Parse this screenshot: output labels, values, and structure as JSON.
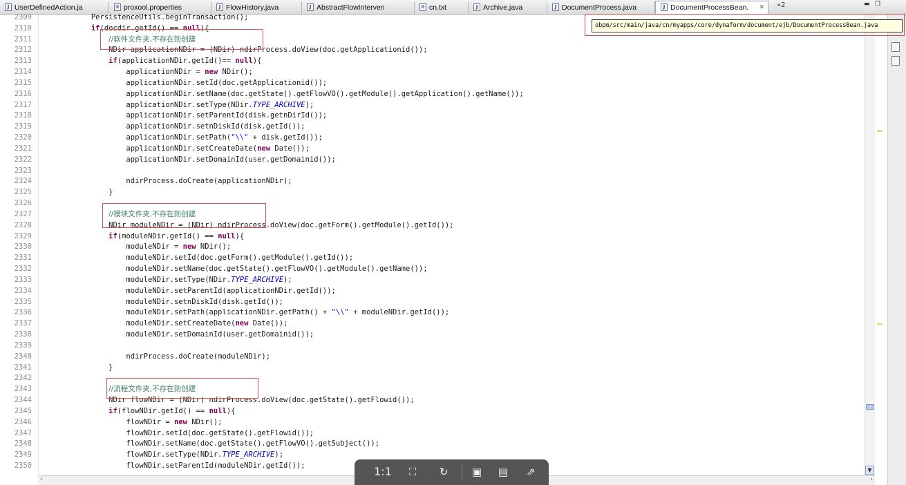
{
  "tabs": [
    {
      "label": "UserDefinedAction.ja",
      "icon": "java-file-icon"
    },
    {
      "label": "proxool.properties",
      "icon": "properties-file-icon"
    },
    {
      "label": "FlowHistory.java",
      "icon": "java-file-icon"
    },
    {
      "label": "AbstractFlowInterven",
      "icon": "java-file-icon"
    },
    {
      "label": "cn.txt",
      "icon": "text-file-icon"
    },
    {
      "label": "Archive.java",
      "icon": "java-file-icon"
    },
    {
      "label": "DocumentProcess.java",
      "icon": "java-file-icon"
    },
    {
      "label": "DocumentProcessBean.",
      "icon": "java-file-icon",
      "active": true
    }
  ],
  "more_tabs": "»2",
  "tooltip_path": "obpm/src/main/java/cn/myapps/core/dynaform/document/ejb/DocumentProcessBean.java",
  "lines": [
    {
      "n": "2309",
      "html": "            PersistenceUtils.beginTransaction();"
    },
    {
      "n": "2310",
      "html": "            <span class='kw'>if</span>(docdir.getId() == <span class='kw'>null</span>){"
    },
    {
      "n": "2311",
      "html": "                <span class='cm'>//软件文件夹,不存在则创建</span>"
    },
    {
      "n": "2312",
      "html": "                NDir applicationNDir = (NDir) ndirProcess.doView(doc.getApplicationid());"
    },
    {
      "n": "2313",
      "html": "                <span class='kw'>if</span>(applicationNDir.getId()== <span class='kw'>null</span>){"
    },
    {
      "n": "2314",
      "html": "                    applicationNDir = <span class='kw'>new</span> NDir();"
    },
    {
      "n": "2315",
      "html": "                    applicationNDir.setId(doc.getApplicationid());"
    },
    {
      "n": "2316",
      "html": "                    applicationNDir.setName(doc.getState().getFlowVO().getModule().getApplication().getName());"
    },
    {
      "n": "2317",
      "html": "                    applicationNDir.setType(NDir.<span class='sf'>TYPE_ARCHIVE</span>);"
    },
    {
      "n": "2318",
      "html": "                    applicationNDir.setParentId(disk.getnDirId());"
    },
    {
      "n": "2319",
      "html": "                    applicationNDir.setnDiskId(disk.getId());"
    },
    {
      "n": "2320",
      "html": "                    applicationNDir.setPath(<span class='st'>\"\\\\\"</span> + disk.getId());"
    },
    {
      "n": "2321",
      "html": "                    applicationNDir.setCreateDate(<span class='kw'>new</span> Date());"
    },
    {
      "n": "2322",
      "html": "                    applicationNDir.setDomainId(user.getDomainid());"
    },
    {
      "n": "2323",
      "html": ""
    },
    {
      "n": "2324",
      "html": "                    ndirProcess.doCreate(applicationNDir);"
    },
    {
      "n": "2325",
      "html": "                }"
    },
    {
      "n": "2326",
      "html": ""
    },
    {
      "n": "2327",
      "html": "                <span class='cm'>//模块文件夹,不存在则创建</span>"
    },
    {
      "n": "2328",
      "html": "                NDir moduleNDir = (NDir) ndirProcess.doView(doc.getForm().getModule().getId());"
    },
    {
      "n": "2329",
      "html": "                <span class='kw'>if</span>(moduleNDir.getId() == <span class='kw'>null</span>){"
    },
    {
      "n": "2330",
      "html": "                    moduleNDir = <span class='kw'>new</span> NDir();"
    },
    {
      "n": "2331",
      "html": "                    moduleNDir.setId(doc.getForm().getModule().getId());"
    },
    {
      "n": "2332",
      "html": "                    moduleNDir.setName(doc.getState().getFlowVO().getModule().getName());"
    },
    {
      "n": "2333",
      "html": "                    moduleNDir.setType(NDir.<span class='sf'>TYPE_ARCHIVE</span>);"
    },
    {
      "n": "2334",
      "html": "                    moduleNDir.setParentId(applicationNDir.getId());"
    },
    {
      "n": "2335",
      "html": "                    moduleNDir.setnDiskId(disk.getId());"
    },
    {
      "n": "2336",
      "html": "                    moduleNDir.setPath(applicationNDir.getPath() + <span class='st'>\"\\\\\"</span> + moduleNDir.getId());"
    },
    {
      "n": "2337",
      "html": "                    moduleNDir.setCreateDate(<span class='kw'>new</span> Date());"
    },
    {
      "n": "2338",
      "html": "                    moduleNDir.setDomainId(user.getDomainid());"
    },
    {
      "n": "2339",
      "html": ""
    },
    {
      "n": "2340",
      "html": "                    ndirProcess.doCreate(moduleNDir);"
    },
    {
      "n": "2341",
      "html": "                }"
    },
    {
      "n": "2342",
      "html": ""
    },
    {
      "n": "2343",
      "html": "                <span class='cm'>//流程文件夹,不存在则创建</span>"
    },
    {
      "n": "2344",
      "html": "                NDir flowNDir = (NDir) ndirProcess.doView(doc.getState().getFlowid());"
    },
    {
      "n": "2345",
      "html": "                <span class='kw'>if</span>(flowNDir.getId() == <span class='kw'>null</span>){"
    },
    {
      "n": "2346",
      "html": "                    flowNDir = <span class='kw'>new</span> NDir();"
    },
    {
      "n": "2347",
      "html": "                    flowNDir.setId(doc.getState().getFlowid());"
    },
    {
      "n": "2348",
      "html": "                    flowNDir.setName(doc.getState().getFlowVO().getSubject());"
    },
    {
      "n": "2349",
      "html": "                    flowNDir.setType(NDir.<span class='sf'>TYPE_ARCHIVE</span>);"
    },
    {
      "n": "2350",
      "html": "                    flowNDir.setParentId(moduleNDir.getId());"
    }
  ],
  "viewer_toolbar": {
    "actual_size_label": "1:1"
  },
  "colors": {
    "keyword": "#7f0055",
    "comment": "#3f7f5f",
    "string": "#2a00ff",
    "static_field": "#0000c0",
    "annotation_box": "#d9534f"
  }
}
